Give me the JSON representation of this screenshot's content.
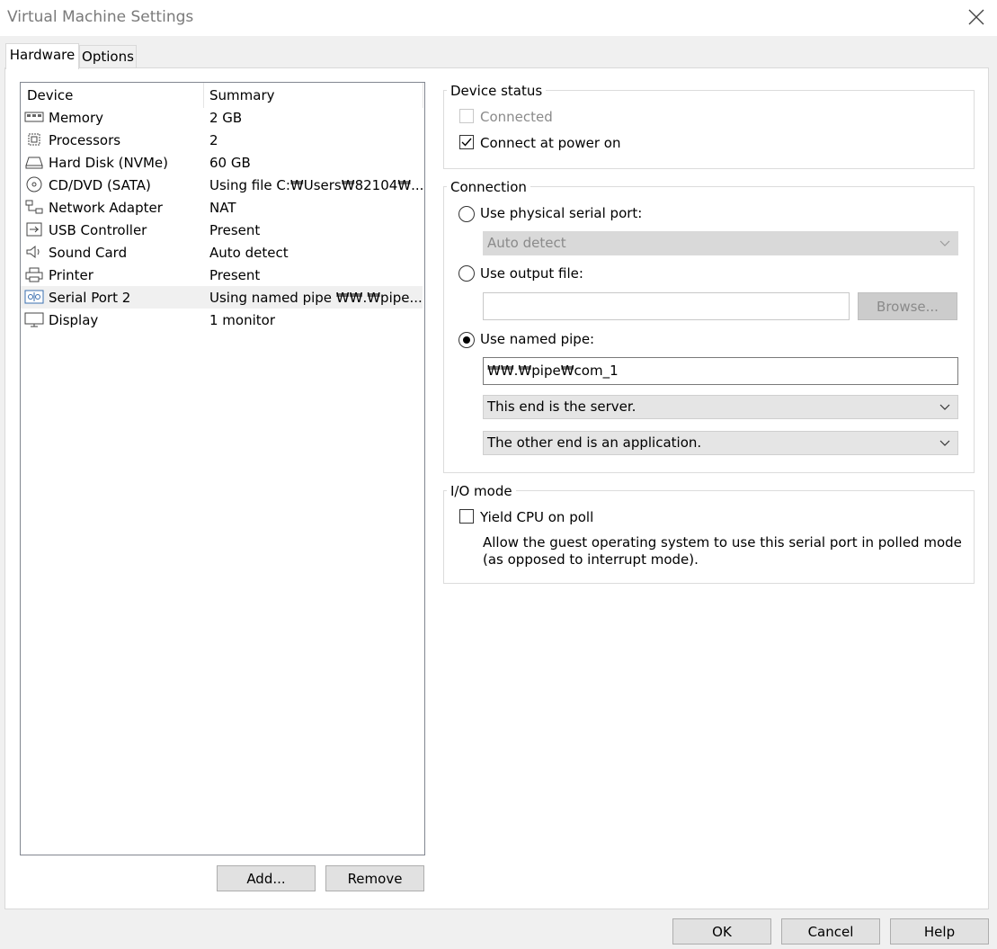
{
  "window": {
    "title": "Virtual Machine Settings"
  },
  "tabs": [
    {
      "label": "Hardware"
    },
    {
      "label": "Options"
    }
  ],
  "device_list": {
    "headers": {
      "device": "Device",
      "summary": "Summary"
    },
    "rows": [
      {
        "icon": "memory-icon",
        "name": "Memory",
        "summary": "2 GB"
      },
      {
        "icon": "processor-icon",
        "name": "Processors",
        "summary": "2"
      },
      {
        "icon": "hard-disk-icon",
        "name": "Hard Disk (NVMe)",
        "summary": "60 GB"
      },
      {
        "icon": "cd-dvd-icon",
        "name": "CD/DVD (SATA)",
        "summary": "Using file C:₩Users₩82104₩..."
      },
      {
        "icon": "network-adapter-icon",
        "name": "Network Adapter",
        "summary": "NAT"
      },
      {
        "icon": "usb-icon",
        "name": "USB Controller",
        "summary": "Present"
      },
      {
        "icon": "sound-card-icon",
        "name": "Sound Card",
        "summary": "Auto detect"
      },
      {
        "icon": "printer-icon",
        "name": "Printer",
        "summary": "Present"
      },
      {
        "icon": "serial-port-icon",
        "name": "Serial Port 2",
        "summary": "Using named pipe ₩₩.₩pipe...",
        "selected": true
      },
      {
        "icon": "display-icon",
        "name": "Display",
        "summary": "1 monitor"
      }
    ],
    "add_label": "Add...",
    "remove_label": "Remove"
  },
  "device_status": {
    "title": "Device status",
    "connected_label": "Connected",
    "connected_checked": false,
    "connected_enabled": false,
    "power_on_label": "Connect at power on",
    "power_on_checked": true
  },
  "connection": {
    "title": "Connection",
    "physical_label": "Use physical serial port:",
    "physical_value": "Auto detect",
    "output_label": "Use output file:",
    "output_value": "",
    "browse_label": "Browse...",
    "pipe_label": "Use named pipe:",
    "pipe_value": "₩₩.₩pipe₩com_1",
    "end_value": "This end is the server.",
    "other_end_value": "The other end is an application.",
    "selected": "pipe"
  },
  "io_mode": {
    "title": "I/O mode",
    "yield_label": "Yield CPU on poll",
    "yield_checked": false,
    "description": "Allow the guest operating system to use this serial port in polled mode (as opposed to interrupt mode)."
  },
  "footer": {
    "ok_label": "OK",
    "cancel_label": "Cancel",
    "help_label": "Help"
  }
}
